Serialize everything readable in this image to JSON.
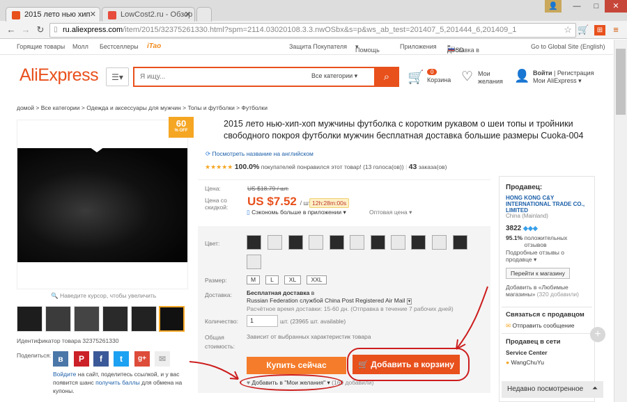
{
  "browser": {
    "tabs": [
      {
        "label": "2015 лето нью хип"
      },
      {
        "label": "LowCost2.ru - Обзор"
      }
    ],
    "url_host": "ru.aliexpress.com",
    "url_path": "/item/2015/32375261330.html?spm=2114.03020108.3.3.nwOSbx&s=p&ws_ab_test=201407_5,201444_6,201409_1"
  },
  "topbar": {
    "left": [
      "Горящие товары",
      "Молл",
      "Бестселлеры",
      "iTao"
    ],
    "right": [
      "Защита Покупателя",
      "Помощь",
      "Приложения",
      "Доставка в",
      "/ USD",
      "Go to Global Site (English)"
    ]
  },
  "header": {
    "logo": "AliExpress",
    "search_placeholder": "Я ищу...",
    "categories": "Все категории",
    "cart_count": "0",
    "cart_label": "Корзина",
    "wish_line1": "Мои",
    "wish_line2": "желания",
    "login": "Войти",
    "register": "Регистрация",
    "my_ali": "Мои AliExpress"
  },
  "breadcrumb": "домой > Все категории > Одежда и аксессуары для мужчин > Топы и футболки > Футболки",
  "product": {
    "discount": "60",
    "discount_unit": "% OFF",
    "zoom_hint": "Наведите курсор, чтобы увеличить",
    "id_text": "Идентификатор товара 32375261330",
    "title": "2015 лето нью-хип-хоп мужчины футболка с коротким рукавом о шеи топы и тройники свободного покроя футболки мужчин бесплатная доставка большие размеры Cuoka-004",
    "translate": "Посмотреть название на английском",
    "rating_pct": "100.0%",
    "rating_text": "покупателей понравился этот товар! (13 голоса(ов))",
    "orders": "43",
    "orders_label": "заказа(ов)",
    "price_label": "Цена:",
    "old_price": "US $18.79 / шт.",
    "sale_label1": "Цена со",
    "sale_label2": "скидкой:",
    "price": "US $7.52",
    "price_unit": "/ шт.",
    "timer": "12h:28m:00s",
    "app_save": "Сэкономь больше в приложении",
    "wholesale": "Оптовая цена",
    "color_label": "Цвет:",
    "size_label": "Размер:",
    "sizes": [
      "M",
      "L",
      "XL",
      "XXL"
    ],
    "ship_label": "Доставка:",
    "ship_free": "Бесплатная доставка",
    "ship_to": "в",
    "ship_line2": "Russian Federation службой China Post Registered Air Mail",
    "ship_line3": "Расчётное время доставки: 15-60 дн. (Отправка в течение 7 рабочих дней)",
    "qty_label": "Количество:",
    "qty_value": "1",
    "qty_avail": "шт. (23965 шт. available)",
    "total_label1": "Общая",
    "total_label2": "стоимость:",
    "total_text": "Зависит от выбранных характеристик товара",
    "buy_now": "Купить сейчас",
    "add_cart": "Добавить в корзину",
    "wishlist": "Добавить в \"Мои желания\"",
    "wish_count": "(169 добавили)"
  },
  "share": {
    "label": "Поделиться:",
    "line1a": "Войдите",
    "line1b": "на сайт, поделитесь ссылкой, и у вас",
    "line2a": "появится шанс",
    "line2b": "получить баллы",
    "line2c": "для обмена на",
    "line3": "купоны."
  },
  "seller": {
    "label": "Продавец:",
    "name": "HONG KONG C&Y INTERNATIONAL TRADE CO., LIMITED",
    "country": "China (Mainland)",
    "score": "3822",
    "positive": "95.1%",
    "positive_label": "положительных отзывов",
    "details": "Подробные отзывы о продавце",
    "store_btn": "Перейти к магазину",
    "fav": "Добавить в «Любимые магазины»",
    "fav_count": "(320 добавили)",
    "contact_title": "Связаться с продавцом",
    "message": "Отправить сообщение",
    "online_title": "Продавец в сети",
    "service": "Service Center",
    "agent": "WangChuYu"
  },
  "recent": "Недавно посмотренное",
  "colors": {
    "accent": "#e8501c",
    "buy": "#f57c2a",
    "annotation": "#cc1d1d"
  }
}
